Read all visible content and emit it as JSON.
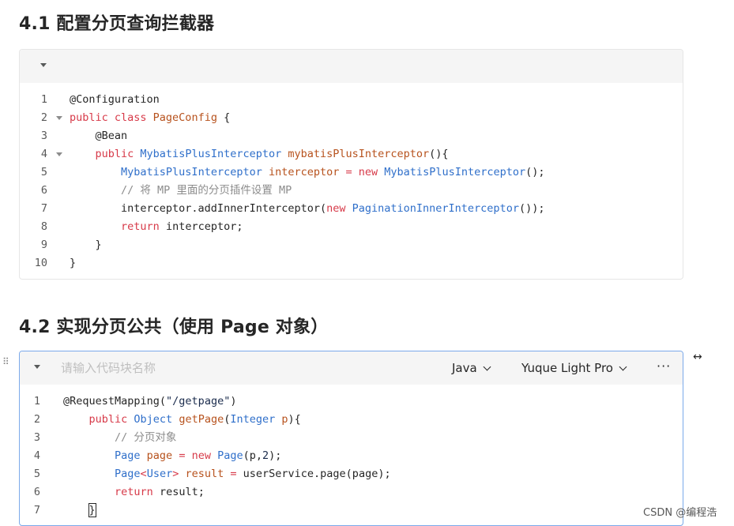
{
  "section1": {
    "title": "4.1 配置分页查询拦截器",
    "lines": [
      {
        "n": "1",
        "parts": [
          [
            "@Configuration",
            ""
          ]
        ]
      },
      {
        "n": "2",
        "parts": [
          [
            "public class ",
            "kw"
          ],
          [
            "PageConfig",
            "fn"
          ],
          [
            " {",
            ""
          ]
        ]
      },
      {
        "n": "3",
        "parts": [
          [
            "    @Bean",
            ""
          ]
        ]
      },
      {
        "n": "4",
        "parts": [
          [
            "    ",
            ""
          ],
          [
            "public ",
            "kw"
          ],
          [
            "MybatisPlusInterceptor ",
            "cls"
          ],
          [
            "mybatisPlusInterceptor",
            "fn"
          ],
          [
            "(){",
            ""
          ]
        ]
      },
      {
        "n": "5",
        "parts": [
          [
            "        ",
            ""
          ],
          [
            "MybatisPlusInterceptor ",
            "cls"
          ],
          [
            "interceptor ",
            "fn"
          ],
          [
            "= ",
            "kw"
          ],
          [
            "new ",
            "kw"
          ],
          [
            "MybatisPlusInterceptor",
            "cls"
          ],
          [
            "();",
            ""
          ]
        ]
      },
      {
        "n": "6",
        "parts": [
          [
            "        // 将 MP 里面的分页插件设置 MP",
            "cm"
          ]
        ]
      },
      {
        "n": "7",
        "parts": [
          [
            "        interceptor.addInnerInterceptor(",
            ""
          ],
          [
            "new ",
            "kw"
          ],
          [
            "PaginationInnerInterceptor",
            "cls"
          ],
          [
            "());",
            ""
          ]
        ]
      },
      {
        "n": "8",
        "parts": [
          [
            "        ",
            ""
          ],
          [
            "return ",
            "kw"
          ],
          [
            "interceptor;",
            ""
          ]
        ]
      },
      {
        "n": "9",
        "parts": [
          [
            "    }",
            ""
          ]
        ]
      },
      {
        "n": "10",
        "parts": [
          [
            "}",
            ""
          ]
        ]
      }
    ]
  },
  "section2": {
    "title": "4.2 实现分页公共（使用 Page 对象）",
    "header": {
      "name_placeholder": "请输入代码块名称",
      "language": "Java",
      "theme": "Yuque Light Pro",
      "more": "···"
    },
    "lines": [
      {
        "n": "1",
        "parts": [
          [
            "@RequestMapping(",
            ""
          ],
          [
            "\"/getpage\"",
            "str"
          ],
          [
            ")",
            ""
          ]
        ]
      },
      {
        "n": "2",
        "parts": [
          [
            "    ",
            ""
          ],
          [
            "public ",
            "kw"
          ],
          [
            "Object ",
            "cls"
          ],
          [
            "getPage",
            "fn"
          ],
          [
            "(",
            ""
          ],
          [
            "Integer ",
            "cls"
          ],
          [
            "p",
            "fn"
          ],
          [
            "){",
            ""
          ]
        ]
      },
      {
        "n": "3",
        "parts": [
          [
            "        // 分页对象",
            "cm"
          ]
        ]
      },
      {
        "n": "4",
        "parts": [
          [
            "        ",
            ""
          ],
          [
            "Page ",
            "cls"
          ],
          [
            "page ",
            "fn"
          ],
          [
            "= ",
            "kw"
          ],
          [
            "new ",
            "kw"
          ],
          [
            "Page",
            "cls"
          ],
          [
            "(p,",
            ""
          ],
          [
            "2",
            "num"
          ],
          [
            ");",
            ""
          ]
        ]
      },
      {
        "n": "5",
        "parts": [
          [
            "        ",
            ""
          ],
          [
            "Page",
            "cls"
          ],
          [
            "<",
            "kw"
          ],
          [
            "User",
            "cls"
          ],
          [
            "> ",
            "kw"
          ],
          [
            "result ",
            "fn"
          ],
          [
            "= ",
            "kw"
          ],
          [
            "userService.page(page);",
            ""
          ]
        ]
      },
      {
        "n": "6",
        "parts": [
          [
            "        ",
            ""
          ],
          [
            "return ",
            "kw"
          ],
          [
            "result;",
            ""
          ]
        ]
      },
      {
        "n": "7",
        "parts": [
          [
            "    }",
            ""
          ]
        ]
      }
    ]
  },
  "icons": {
    "drag_handle": "drag-handle-icon",
    "expand_width": "expand-width-icon",
    "collapse": "caret-down-icon"
  },
  "side_icon_glyph": "↔",
  "grip_glyph": "⠿",
  "watermark": "CSDN @编程浩"
}
